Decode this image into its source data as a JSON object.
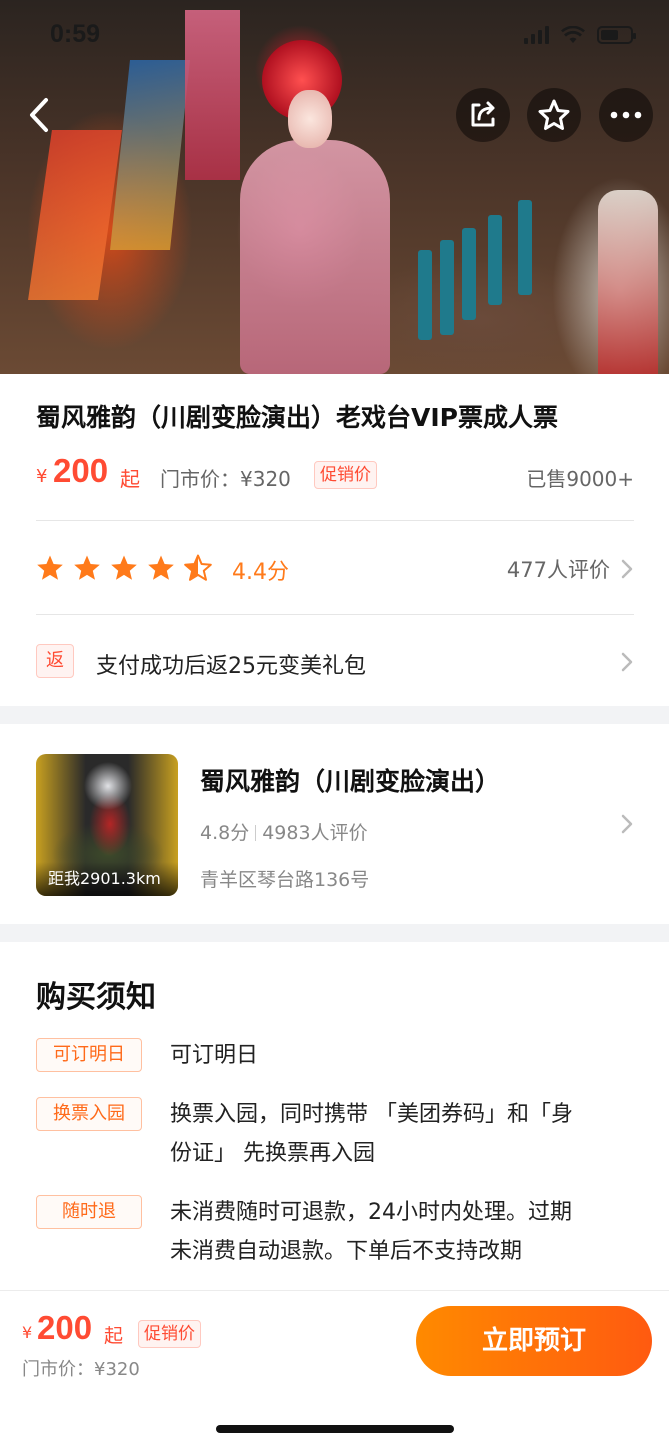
{
  "status_bar": {
    "time": "0:59"
  },
  "hero": {
    "icons": [
      "back-icon",
      "share-icon",
      "star-icon",
      "more-icon"
    ]
  },
  "product": {
    "title": "蜀风雅韵（川剧变脸演出）老戏台VIP票成人票",
    "currency": "¥",
    "price": "200",
    "price_suffix": "起",
    "market_price": "门市价：¥320",
    "promo_tag": "促销价",
    "sold": "已售9000+"
  },
  "rating": {
    "stars": 4.5,
    "score_text": "4.4分",
    "reviews_text": "477人评价",
    "star_color": "#ff7a1a"
  },
  "rebate": {
    "tag": "返",
    "text": "支付成功后返25元变美礼包"
  },
  "venue": {
    "distance": "距我2901.3km",
    "name": "蜀风雅韵（川剧变脸演出）",
    "score": "4.8分",
    "reviews": "4983人评价",
    "address": "青羊区琴台路136号"
  },
  "notice": {
    "title": "购买须知",
    "items": [
      {
        "tag": "可订明日",
        "line1": "可订明日",
        "line2": ""
      },
      {
        "tag": "换票入园",
        "line1": "换票入园，同时携带 「美团券码」和「身",
        "line2": "份证」 先换票再入园"
      },
      {
        "tag": "随时退",
        "line1": "未消费随时可退款，24小时内处理。过期",
        "line2": "未消费自动退款。下单后不支持改期"
      }
    ]
  },
  "bottom_bar": {
    "currency": "¥",
    "price": "200",
    "price_suffix": "起",
    "promo_tag": "促销价",
    "market_price": "门市价：¥320",
    "book_label": "立即预订"
  },
  "colors": {
    "accent_red": "#ff4b33",
    "accent_orange": "#ff7a1a",
    "button_gradient_start": "#ff8a00",
    "button_gradient_end": "#ff5a10"
  }
}
